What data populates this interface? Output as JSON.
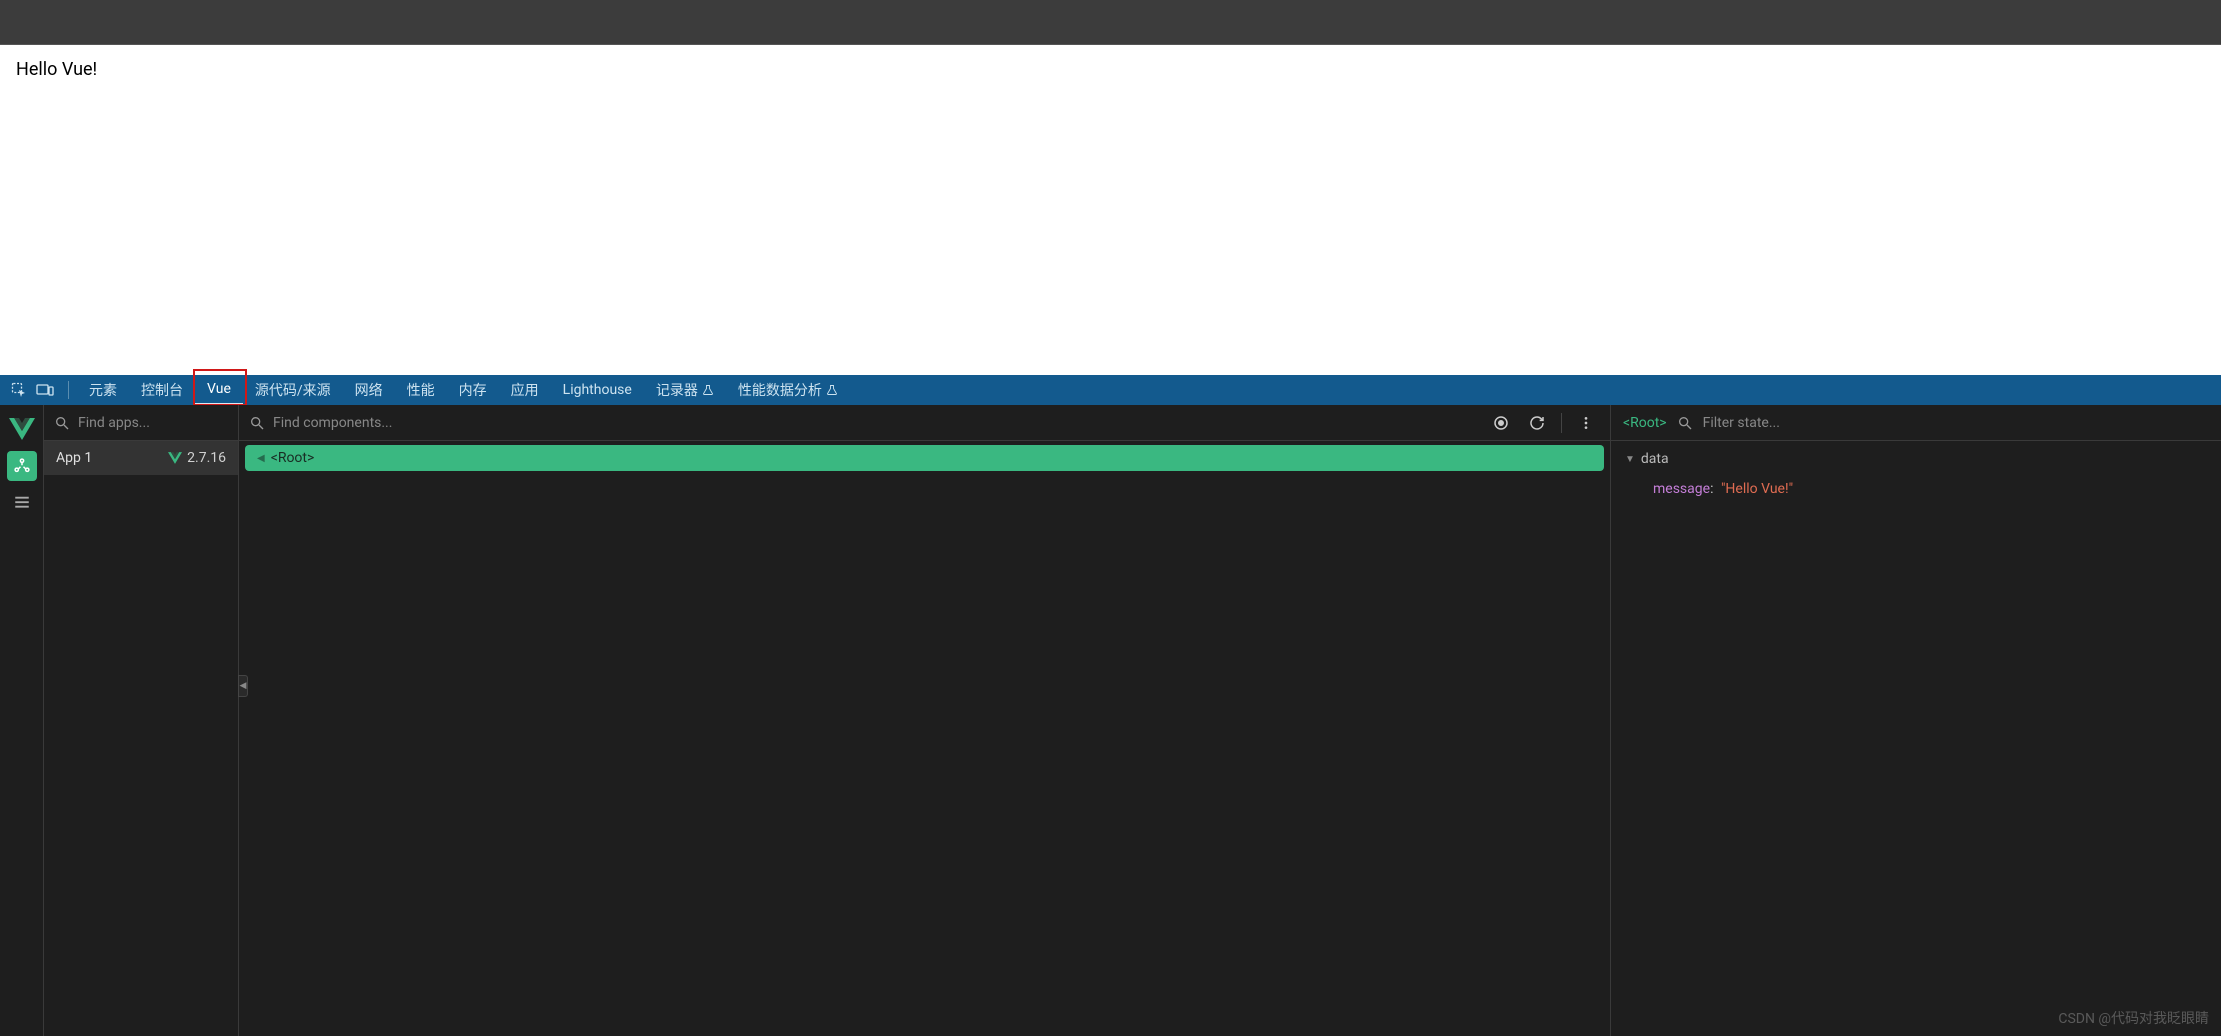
{
  "page": {
    "content": "Hello Vue!"
  },
  "devtools": {
    "tabs": {
      "elements": "元素",
      "console": "控制台",
      "vue": "Vue",
      "sources": "源代码/来源",
      "network": "网络",
      "performance": "性能",
      "memory": "内存",
      "application": "应用",
      "lighthouse": "Lighthouse",
      "recorder": "记录器",
      "insights": "性能数据分析"
    }
  },
  "vue_panel": {
    "apps": {
      "search_placeholder": "Find apps...",
      "app_name": "App 1",
      "version": "2.7.16"
    },
    "components": {
      "search_placeholder": "Find components...",
      "root_label": "<Root>"
    },
    "state": {
      "root_label": "<Root>",
      "filter_placeholder": "Filter state...",
      "section": "data",
      "kv": {
        "key": "message",
        "value": "\"Hello Vue!\""
      }
    }
  },
  "watermark": "CSDN @代码对我眨眼睛"
}
